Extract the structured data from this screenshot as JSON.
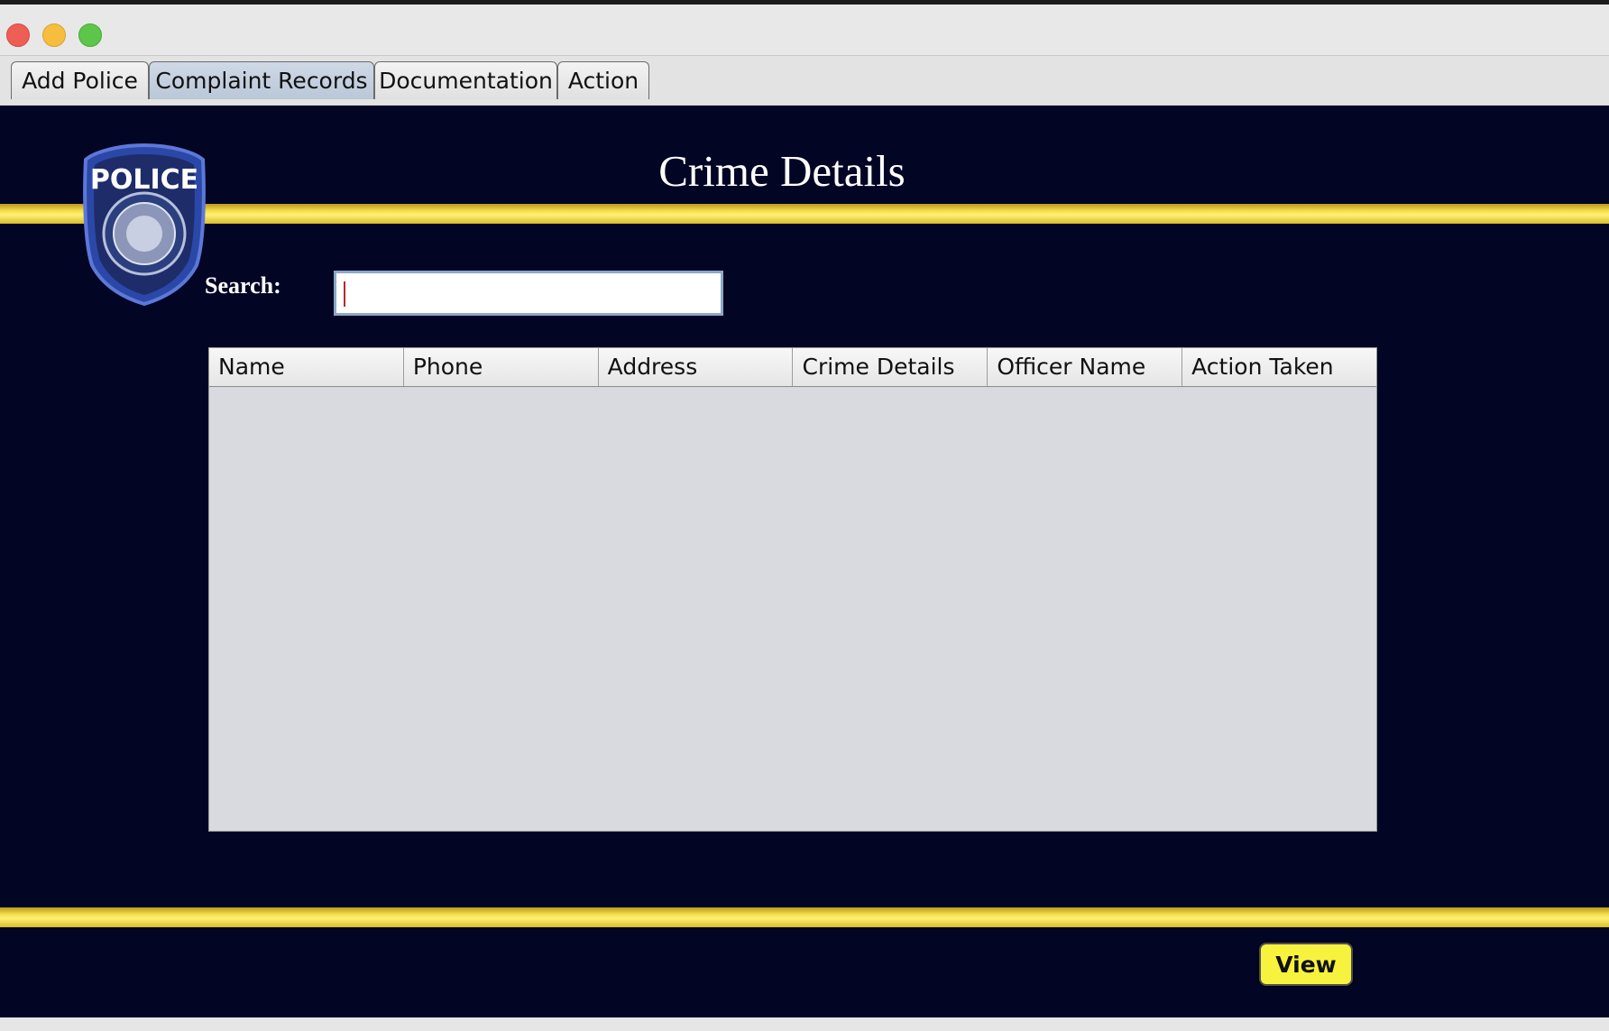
{
  "window": {
    "controls": [
      "close",
      "minimize",
      "maximize"
    ]
  },
  "tabs": [
    {
      "label": "Add Police",
      "active": false
    },
    {
      "label": "Complaint Records",
      "active": true
    },
    {
      "label": "Documentation",
      "active": false
    },
    {
      "label": "Action",
      "active": false
    }
  ],
  "panel": {
    "title": "Crime Details",
    "badge_text": "POLICE",
    "search": {
      "label": "Search:",
      "value": "",
      "placeholder": ""
    },
    "table": {
      "columns": [
        "Name",
        "Phone",
        "Address",
        "Crime Details",
        "Officer Name",
        "Action Taken"
      ],
      "rows": []
    },
    "view_button": "View"
  },
  "colors": {
    "background": "#030525",
    "stripe": "#f5dd4b",
    "button": "#f7f23d",
    "active_tab": "#c2cede"
  }
}
